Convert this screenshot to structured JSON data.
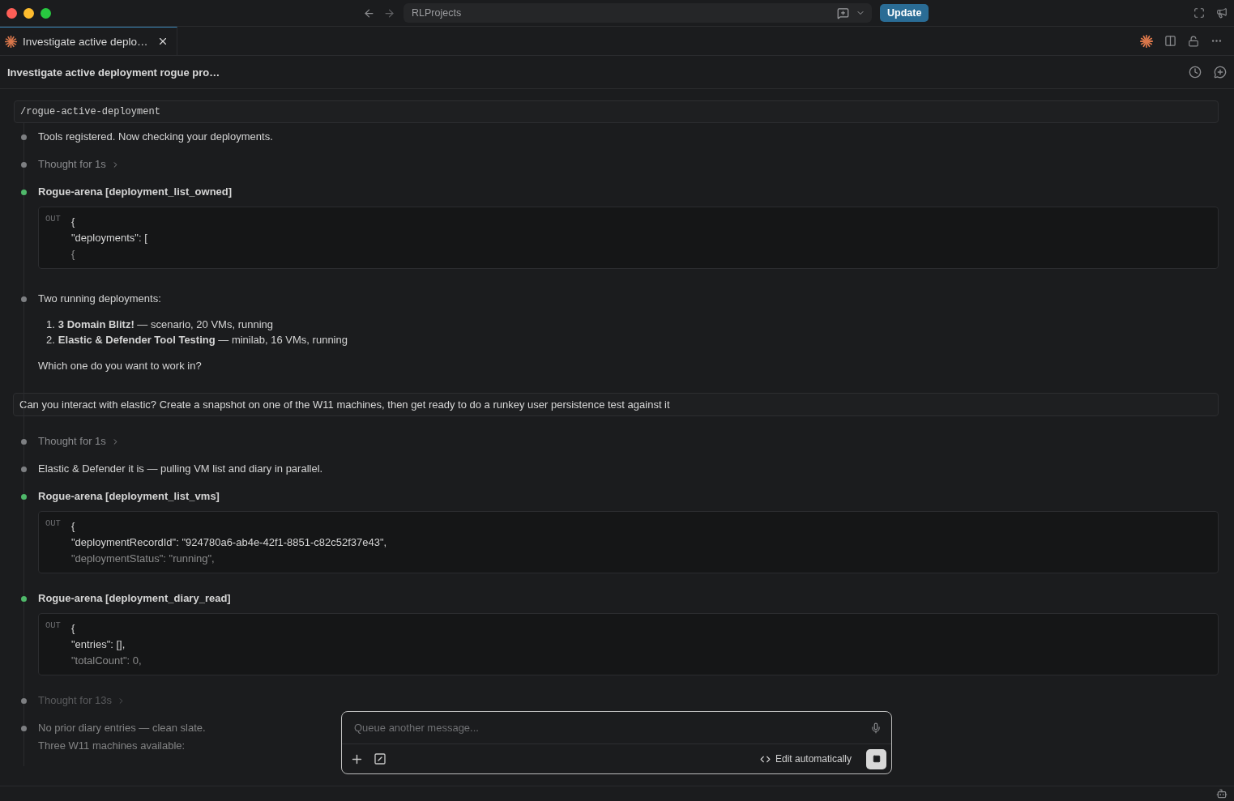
{
  "titlebar": {
    "address": "RLProjects",
    "update_button": "Update"
  },
  "tabs": [
    {
      "label": "Investigate active deplo…",
      "selected": true
    }
  ],
  "header": {
    "title": "Investigate active deployment rogue pro…"
  },
  "command": "/rogue-active-deployment",
  "timeline": [
    {
      "kind": "text",
      "color": "#7d7f82",
      "dimmed": false,
      "lines": [
        "Tools registered. Now checking your deployments."
      ]
    },
    {
      "kind": "thought",
      "color": "#7d7f82",
      "dimmed": false,
      "text": "Thought for 1s"
    },
    {
      "kind": "tool",
      "color": "#4fb86a",
      "dimmed": false,
      "title": "Rogue-arena [deployment_list_owned]",
      "out_label": "OUT",
      "lines": [
        "{",
        "\"deployments\": [",
        "{"
      ]
    },
    {
      "kind": "answer",
      "color": "#7d7f82",
      "dimmed": false,
      "intro": "Two running deployments:",
      "items": [
        {
          "number": "1.",
          "text": "**3 Domain Blitz!** — scenario, 20 VMs, running"
        },
        {
          "number": "2.",
          "text": "**Elastic & Defender Tool Testing** — minilab, 16 VMs, running"
        }
      ],
      "outro": "Which one do you want to work in?"
    },
    {
      "kind": "user",
      "text": "Can you interact with elastic? Create a snapshot on one of the W11 machines, then get ready to do a runkey user persistence test against it"
    },
    {
      "kind": "thought",
      "color": "#7d7f82",
      "dimmed": false,
      "text": "Thought for 1s"
    },
    {
      "kind": "text",
      "color": "#7d7f82",
      "dimmed": false,
      "lines": [
        "Elastic & Defender it is — pulling VM list and diary in parallel."
      ]
    },
    {
      "kind": "tool",
      "color": "#4fb86a",
      "dimmed": false,
      "title": "Rogue-arena [deployment_list_vms]",
      "out_label": "OUT",
      "lines": [
        "{",
        "\"deploymentRecordId\": \"924780a6-ab4e-42f1-8851-c82c52f37e43\",",
        "\"deploymentStatus\": \"running\","
      ]
    },
    {
      "kind": "tool",
      "color": "#4fb86a",
      "dimmed": false,
      "title": "Rogue-arena [deployment_diary_read]",
      "out_label": "OUT",
      "lines": [
        "{",
        "\"entries\": [],",
        "\"totalCount\": 0,"
      ]
    },
    {
      "kind": "thought",
      "color": "#7d7f82",
      "dimmed": true,
      "text": "Thought for 13s"
    },
    {
      "kind": "text",
      "color": "#7d7f82",
      "dimmed": true,
      "lines": [
        "No prior diary entries — clean slate.",
        "Three W11 machines available:"
      ]
    }
  ],
  "composer": {
    "placeholder": "Queue another message...",
    "mode": "Edit automatically"
  }
}
